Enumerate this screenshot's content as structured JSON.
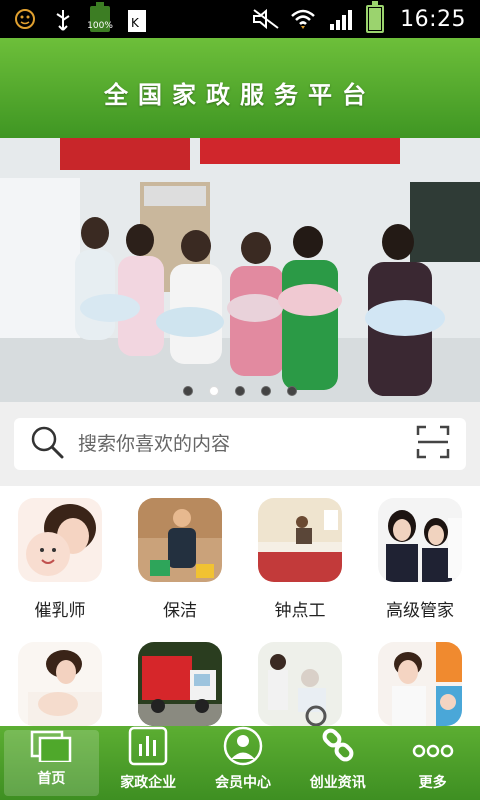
{
  "status_bar": {
    "time": "16:25",
    "battery_small_label": "100%"
  },
  "header": {
    "title": "全国家政服务平台"
  },
  "banner": {
    "dots": [
      false,
      true,
      false,
      false,
      false
    ]
  },
  "search": {
    "placeholder": "搜索你喜欢的内容"
  },
  "categories": [
    {
      "label": "催乳师"
    },
    {
      "label": "保洁"
    },
    {
      "label": "钟点工"
    },
    {
      "label": "高级管家"
    },
    {
      "label": ""
    },
    {
      "label": ""
    },
    {
      "label": ""
    },
    {
      "label": ""
    }
  ],
  "bottom_nav": [
    {
      "label": "首页",
      "icon": "home-icon"
    },
    {
      "label": "家政企业",
      "icon": "chart-icon"
    },
    {
      "label": "会员中心",
      "icon": "user-icon"
    },
    {
      "label": "创业资讯",
      "icon": "link-icon"
    },
    {
      "label": "更多",
      "icon": "more-icon"
    }
  ],
  "colors": {
    "brand_green": "#4fa82b",
    "status_bar": "#000000"
  }
}
